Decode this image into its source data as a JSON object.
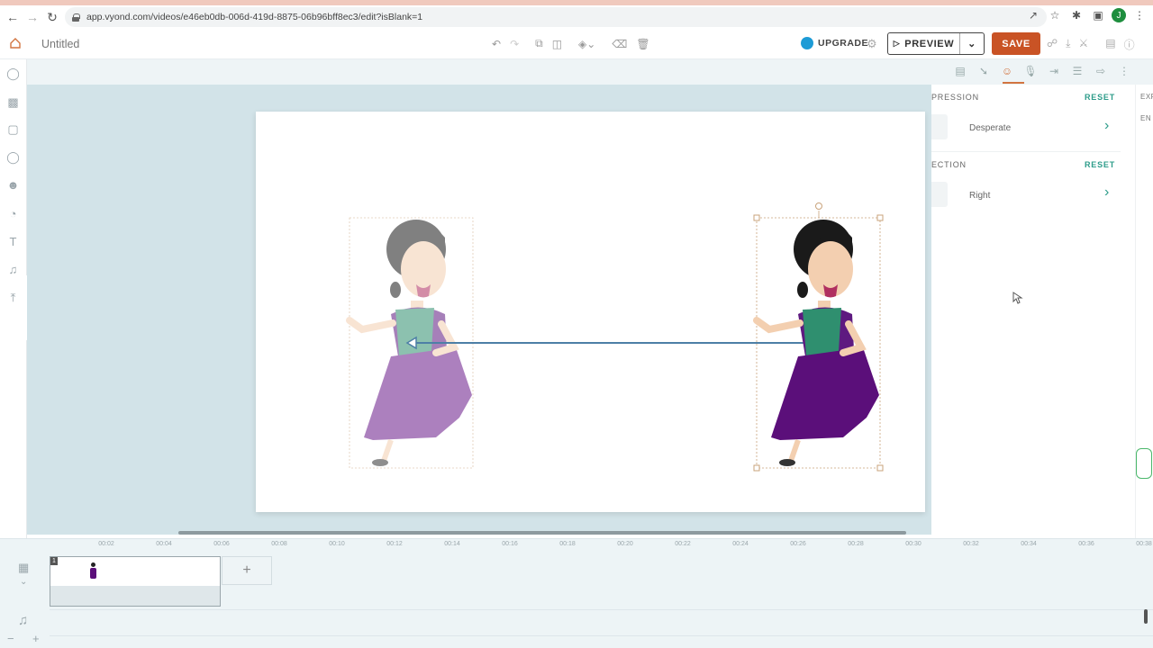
{
  "browser": {
    "url": "app.vyond.com/videos/e46eb0db-006d-419d-8875-06b96bff8ec3/edit?isBlank=1",
    "avatar_letter": "J"
  },
  "header": {
    "title": "Untitled",
    "upgrade_label": "UPGRADE",
    "preview_label": "PREVIEW",
    "save_label": "SAVE"
  },
  "panel": {
    "expression": {
      "label": "PRESSION",
      "reset": "RESET",
      "value": "Desperate"
    },
    "direction": {
      "label": "ECTION",
      "reset": "RESET",
      "value": "Right"
    },
    "far_label_1": "EXP",
    "far_label_2": "EN"
  },
  "timeline": {
    "ticks": [
      "00:02",
      "00:04",
      "00:06",
      "00:08",
      "00:10",
      "00:12",
      "00:14",
      "00:16",
      "00:18",
      "00:20",
      "00:22",
      "00:24",
      "00:26",
      "00:28",
      "00:30",
      "00:32",
      "00:34",
      "00:36",
      "00:38"
    ],
    "scene_number": "1"
  },
  "colors": {
    "accent": "#c95325",
    "teal": "#2d9c8a",
    "stage": "#d2e3e8"
  }
}
